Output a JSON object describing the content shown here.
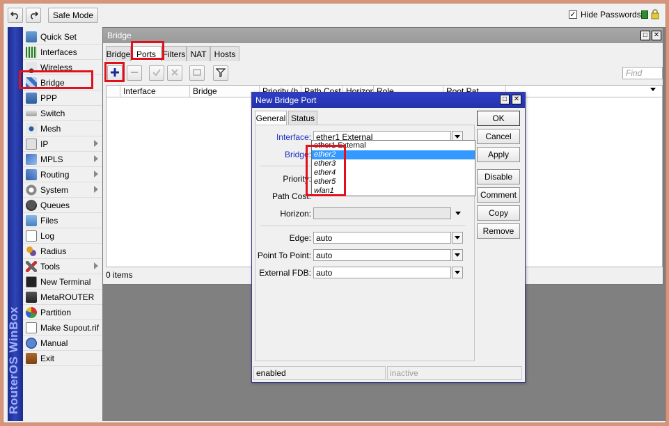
{
  "toolbar": {
    "undo_icon": "undo-icon",
    "redo_icon": "redo-icon",
    "safe_mode": "Safe Mode",
    "hide_passwords": "Hide Passwords",
    "hide_passwords_checked": "✓"
  },
  "sidebar": {
    "brand": "RouterOS WinBox",
    "items": [
      {
        "label": "Quick Set"
      },
      {
        "label": "Interfaces"
      },
      {
        "label": "Wireless"
      },
      {
        "label": "Bridge"
      },
      {
        "label": "PPP"
      },
      {
        "label": "Switch"
      },
      {
        "label": "Mesh"
      },
      {
        "label": "IP"
      },
      {
        "label": "MPLS"
      },
      {
        "label": "Routing"
      },
      {
        "label": "System"
      },
      {
        "label": "Queues"
      },
      {
        "label": "Files"
      },
      {
        "label": "Log"
      },
      {
        "label": "Radius"
      },
      {
        "label": "Tools"
      },
      {
        "label": "New Terminal"
      },
      {
        "label": "MetaROUTER"
      },
      {
        "label": "Partition"
      },
      {
        "label": "Make Supout.rif"
      },
      {
        "label": "Manual"
      },
      {
        "label": "Exit"
      }
    ]
  },
  "bridge_window": {
    "title": "Bridge",
    "tabs": [
      "Bridge",
      "Ports",
      "Filters",
      "NAT",
      "Hosts"
    ],
    "find_placeholder": "Find",
    "columns": [
      "Interface",
      "Bridge",
      "Priority (h...",
      "Path Cost",
      "Horizon",
      "Role",
      "Root Pat..."
    ],
    "item_count": "0 items"
  },
  "dialog": {
    "title": "New Bridge Port",
    "tabs": [
      "General",
      "Status"
    ],
    "fields": {
      "interface_label": "Interface:",
      "interface_value": "ether1 External",
      "bridge_label": "Bridge:",
      "priority_label": "Priority:",
      "path_cost_label": "Path Cost:",
      "horizon_label": "Horizon:",
      "edge_label": "Edge:",
      "edge_value": "auto",
      "p2p_label": "Point To Point:",
      "p2p_value": "auto",
      "ext_fdb_label": "External FDB:",
      "ext_fdb_value": "auto"
    },
    "dropdown_options": [
      "ether1 External",
      "ether2",
      "ether3",
      "ether4",
      "ether5",
      "wlan1"
    ],
    "buttons": [
      "OK",
      "Cancel",
      "Apply",
      "Disable",
      "Comment",
      "Copy",
      "Remove"
    ],
    "status_left": "enabled",
    "status_right": "inactive"
  },
  "colors": {
    "highlight_red": "#e0101c",
    "title_blue": "#2232a8",
    "selection_blue": "#3399ff"
  }
}
